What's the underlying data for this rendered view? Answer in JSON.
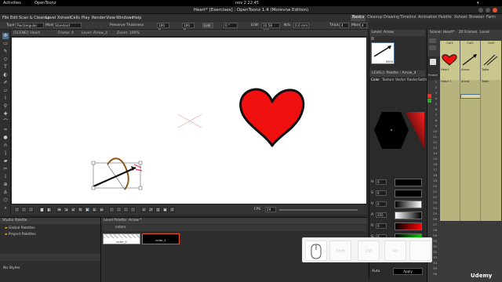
{
  "system": {
    "activities": "Activities",
    "app": "OpenToonz",
    "clock": "nov 2  22:45"
  },
  "window": {
    "title": "Heart* [Exercises] : OpenToonz 1.4 (Morevna Edition)"
  },
  "menu": [
    "File",
    "Edit",
    "Scan & Cleanup",
    "Level",
    "Xsheet",
    "Cells",
    "Play",
    "Render",
    "View",
    "Windows",
    "Help"
  ],
  "rooms": [
    "Basics",
    "Cleanup",
    "Drawing",
    "Timeline",
    "Animation",
    "Palette",
    "Xsheet",
    "Browser",
    "Farm"
  ],
  "tool_options": {
    "type_label": "Type:",
    "type_value": "Rectangular",
    "mode_label": "Mode:",
    "mode_value": "Standard",
    "preserve": "Preserve Thickness",
    "h_value": "100 %",
    "v_value": "100 %",
    "link": "Link",
    "rot_value": "0 °",
    "ew_label": "E/W:",
    "ew_value": "10.58 mm",
    "ns_label": "N/S:",
    "ns_value": "0.0 mm",
    "thick_label": "Thick:",
    "thick_value": "4",
    "miter_label": "Miter:",
    "miter_value": "4"
  },
  "viewer": {
    "header": [
      "[SCENE]: Heart",
      "Frame: 4",
      "Level: Arrow_4",
      "Zoom: 100%"
    ],
    "fps_label": "FPS",
    "fps_value": "24"
  },
  "level_strip": {
    "title": "Level: Arrow",
    "frame_label": "0004"
  },
  "style_editor": {
    "tabs": [
      "Color",
      "Texture",
      "Vector",
      "Raster",
      "Settings"
    ],
    "title": "LEVEL]: Palette : Arrow_4",
    "sliders": [
      {
        "label": "H",
        "value": "0"
      },
      {
        "label": "S",
        "value": "0"
      },
      {
        "label": "V",
        "value": "0"
      },
      {
        "label": "A",
        "value": "255"
      },
      {
        "label": "R",
        "value": "0"
      },
      {
        "label": "G",
        "value": "0"
      },
      {
        "label": "B",
        "value": "0"
      }
    ],
    "apply_label": "Auto",
    "apply_btn": "Apply"
  },
  "xsheet": {
    "scene_label": "Scene: Heart*",
    "frames_label": "20 Frames",
    "level_label": "Level",
    "columns": [
      "Col1",
      "Col2",
      "Col3"
    ],
    "column_names": [
      "Heart",
      "Arrow",
      "Table"
    ],
    "frame_col_label": "Frame",
    "rows": [
      "1",
      "2",
      "3",
      "4",
      "5",
      "6",
      "7",
      "8",
      "9",
      "10",
      "11",
      "12",
      "13",
      "14",
      "15",
      "16",
      "17",
      "18",
      "19",
      "20",
      "21",
      "22",
      "23",
      "24",
      "25",
      "26",
      "27",
      "28",
      "29",
      "30",
      "31",
      "32",
      "33",
      "34",
      "35",
      "36"
    ],
    "cells": [
      [
        "Heart 1",
        "Arrow",
        "Table"
      ]
    ]
  },
  "studio_palette": {
    "title": "Studio Palette",
    "items": [
      "Global Palettes",
      "Project Palettes"
    ],
    "status": "No Styles"
  },
  "level_palette": {
    "title": "Level Palette: Arrow *",
    "name": "colors",
    "chips": [
      {
        "label": "color_0"
      },
      {
        "label": "color_1"
      }
    ]
  },
  "keys": {
    "shift": "Shift",
    "ctrl": "Ctrl",
    "alt": "Alt"
  },
  "watermark": "Udemy",
  "colors": {
    "heart_fill": "#f01010",
    "heart_stroke": "#111111",
    "xsheet_cells": "#b7b37c",
    "canvas": "#ffffff"
  }
}
